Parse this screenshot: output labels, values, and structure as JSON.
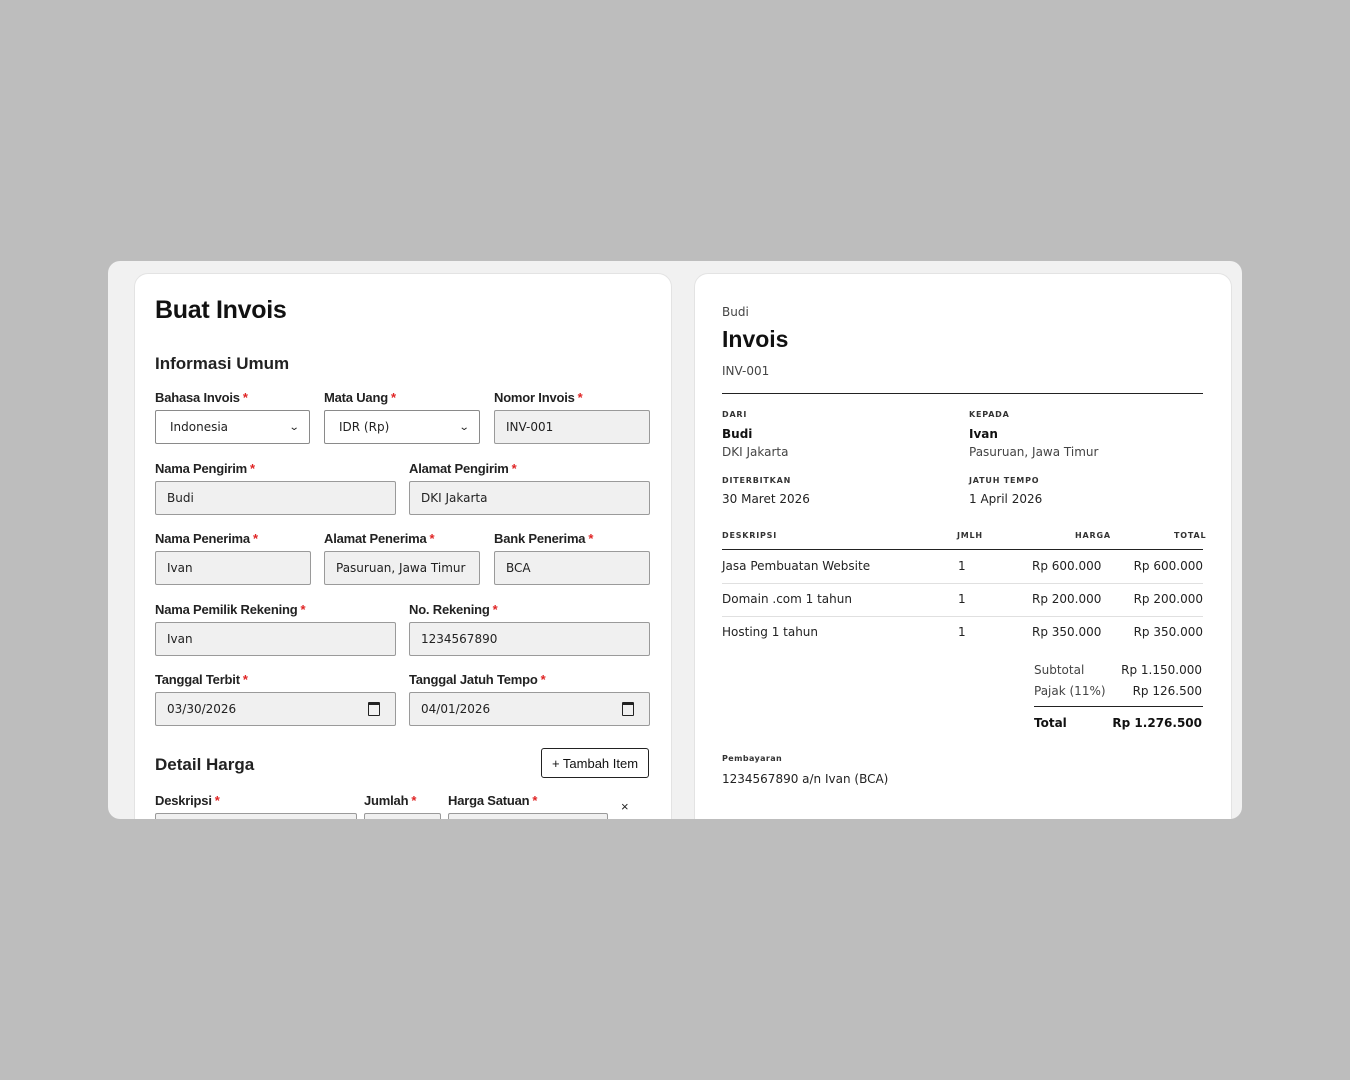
{
  "form": {
    "title": "Buat Invois",
    "section_general": "Informasi Umum",
    "section_price": "Detail Harga",
    "required_mark": "*",
    "fields": {
      "language": {
        "label": "Bahasa Invois",
        "value": "Indonesia"
      },
      "currency": {
        "label": "Mata Uang",
        "value": "IDR (Rp)"
      },
      "invoice_number": {
        "label": "Nomor Invois",
        "value": "INV-001"
      },
      "sender_name": {
        "label": "Nama Pengirim",
        "value": "Budi"
      },
      "sender_address": {
        "label": "Alamat Pengirim",
        "value": "DKI Jakarta"
      },
      "recipient_name": {
        "label": "Nama Penerima",
        "value": "Ivan"
      },
      "recipient_address": {
        "label": "Alamat Penerima",
        "value": "Pasuruan, Jawa Timur"
      },
      "recipient_bank": {
        "label": "Bank Penerima",
        "value": "BCA"
      },
      "account_owner": {
        "label": "Nama Pemilik Rekening",
        "value": "Ivan"
      },
      "account_number": {
        "label": "No. Rekening",
        "value": "1234567890"
      },
      "issue_date": {
        "label": "Tanggal Terbit",
        "value": "03/30/2026"
      },
      "due_date": {
        "label": "Tanggal Jatuh Tempo",
        "value": "04/01/2026"
      }
    },
    "add_item_label": "+ Tambah Item",
    "item_columns": {
      "description": "Deskripsi",
      "qty": "Jumlah",
      "unit_price": "Harga Satuan"
    },
    "remove_label": "×"
  },
  "preview": {
    "sender": "Budi",
    "title": "Invois",
    "number": "INV-001",
    "from_caption": "DARI",
    "to_caption": "KEPADA",
    "from_name": "Budi",
    "from_address": "DKI Jakarta",
    "to_name": "Ivan",
    "to_address": "Pasuruan, Jawa Timur",
    "issued_caption": "DITERBITKAN",
    "due_caption": "JATUH TEMPO",
    "issued_date": "30 Maret 2026",
    "due_date": "1 April 2026",
    "table_headers": {
      "description": "DESKRIPSI",
      "qty": "JMLH",
      "price": "HARGA",
      "total": "TOTAL"
    },
    "items": [
      {
        "description": "Jasa Pembuatan Website",
        "qty": "1",
        "price": "Rp 600.000",
        "total": "Rp 600.000"
      },
      {
        "description": "Domain .com 1 tahun",
        "qty": "1",
        "price": "Rp 200.000",
        "total": "Rp 200.000"
      },
      {
        "description": "Hosting 1 tahun",
        "qty": "1",
        "price": "Rp 350.000",
        "total": "Rp 350.000"
      }
    ],
    "subtotal_label": "Subtotal",
    "subtotal_value": "Rp 1.150.000",
    "tax_label": "Pajak (11%)",
    "tax_value": "Rp 126.500",
    "total_label": "Total",
    "total_value": "Rp 1.276.500",
    "payment_caption": "Pembayaran",
    "payment_info": "1234567890 a/n Ivan (BCA)"
  }
}
